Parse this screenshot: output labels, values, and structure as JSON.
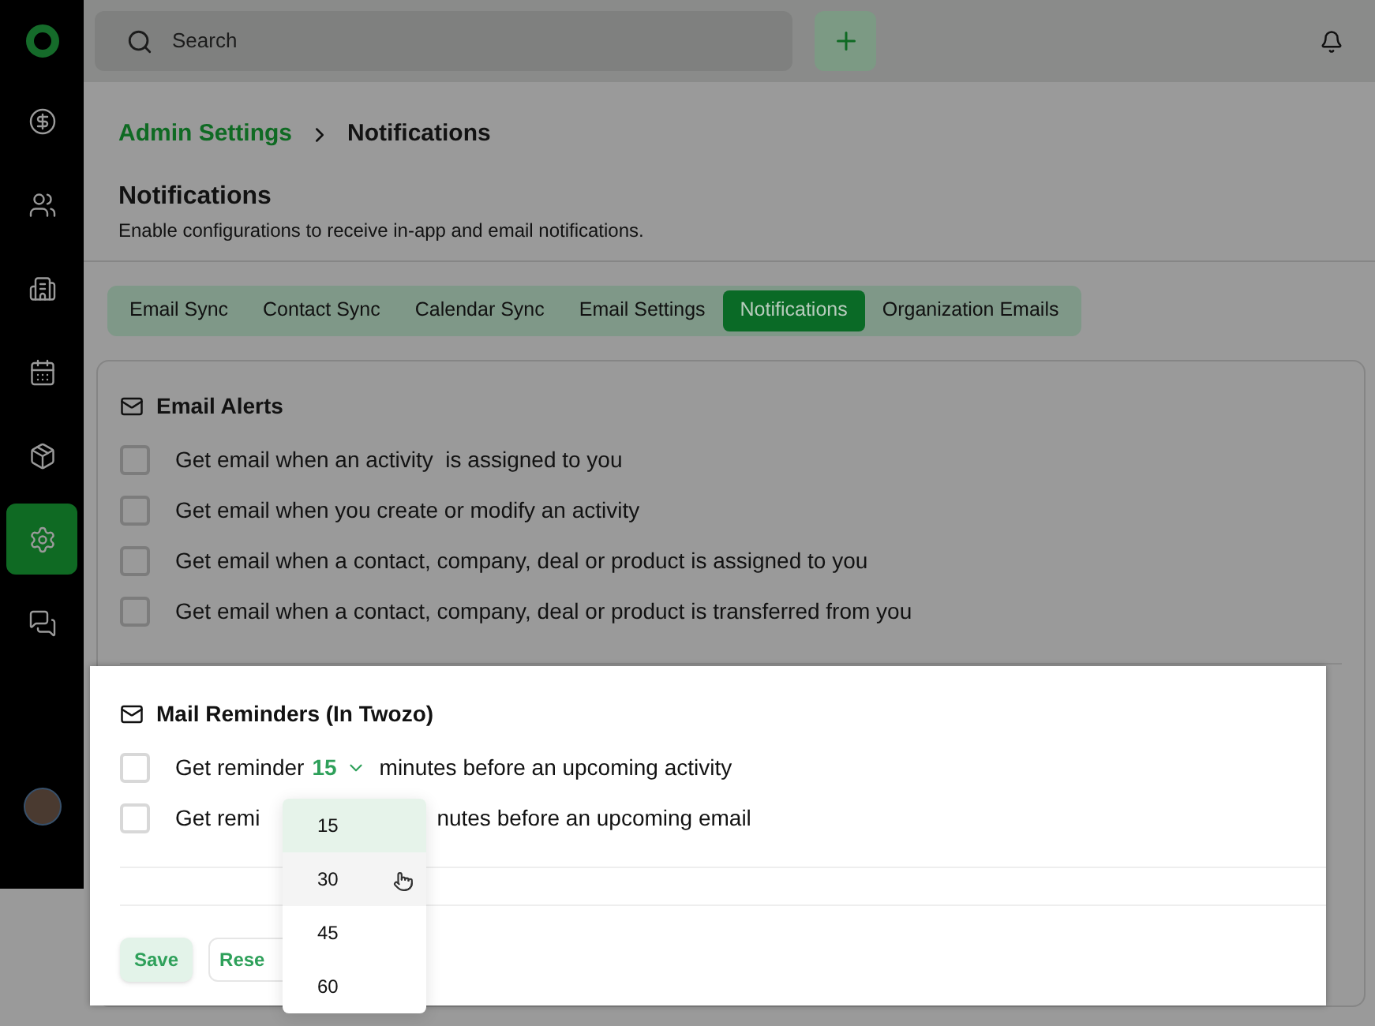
{
  "sidebar": {
    "items": [
      {
        "kind": "deals",
        "selected": false
      },
      {
        "kind": "contacts",
        "selected": false
      },
      {
        "kind": "companies",
        "selected": false
      },
      {
        "kind": "calendar",
        "selected": false
      },
      {
        "kind": "products",
        "selected": false
      },
      {
        "kind": "settings",
        "selected": true
      },
      {
        "kind": "chat",
        "selected": false
      }
    ]
  },
  "search": {
    "placeholder": "Search"
  },
  "breadcrumb": {
    "parent": "Admin Settings",
    "current": "Notifications"
  },
  "page": {
    "title": "Notifications",
    "subtitle": "Enable configurations to receive in-app and email notifications."
  },
  "tabs": [
    {
      "label": "Email Sync",
      "selected": false
    },
    {
      "label": "Contact Sync",
      "selected": false
    },
    {
      "label": "Calendar Sync",
      "selected": false
    },
    {
      "label": "Email Settings",
      "selected": false
    },
    {
      "label": "Notifications",
      "selected": true
    },
    {
      "label": "Organization Emails",
      "selected": false
    }
  ],
  "email_alerts": {
    "title": "Email Alerts",
    "options": [
      {
        "label": "Get email when an activity  is assigned to you",
        "checked": false
      },
      {
        "label": "Get email when you create or modify an activity",
        "checked": false
      },
      {
        "label": "Get email when a contact, company, deal or product is assigned to you",
        "checked": false
      },
      {
        "label": "Get email when a contact, company, deal or product is transferred from you",
        "checked": false
      }
    ]
  },
  "mail_reminders": {
    "title": "Mail Reminders (In Twozo)",
    "rows": [
      {
        "kind": "select",
        "checked": false,
        "prefix": "Get reminder",
        "value": "15",
        "suffix": "minutes before an upcoming activity"
      },
      {
        "kind": "covered",
        "checked": false,
        "prefix": "Get remi",
        "suffix": "nutes before an upcoming email"
      }
    ]
  },
  "dropdown": {
    "options": [
      {
        "label": "15",
        "selected": true,
        "hovered": false
      },
      {
        "label": "30",
        "selected": false,
        "hovered": true
      },
      {
        "label": "45",
        "selected": false,
        "hovered": false
      },
      {
        "label": "60",
        "selected": false,
        "hovered": false
      }
    ]
  },
  "buttons": [
    {
      "label": "Save",
      "kind": "primary"
    },
    {
      "label": "Rese",
      "kind": "secondary"
    }
  ]
}
